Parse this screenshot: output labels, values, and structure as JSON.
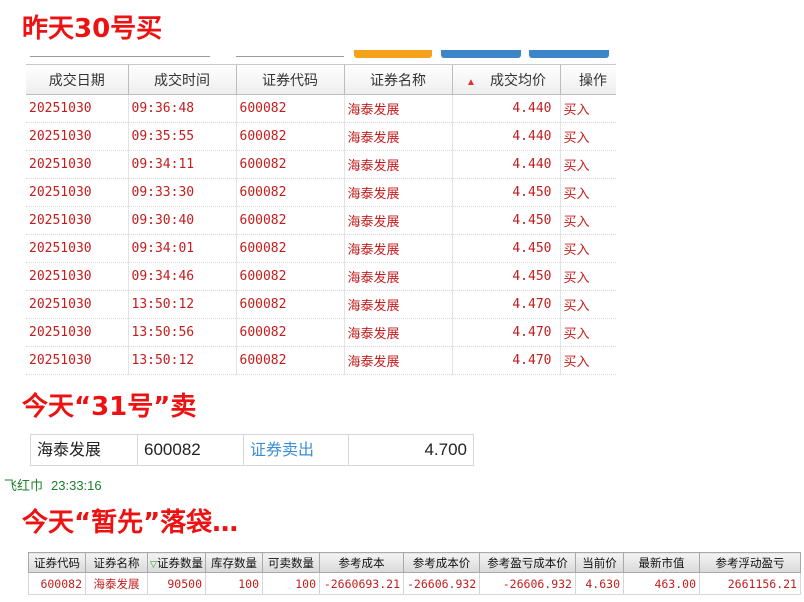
{
  "headings": {
    "bought": "昨天30号买",
    "sold": "今天“31号”卖",
    "result": "今天“暂先”落袋…"
  },
  "colors": {
    "heading": "#ee1111",
    "trade_text": "#c41c1c",
    "link": "#3d8fd6",
    "orange_button": "#f4a21a",
    "blue_button": "#3e84c8"
  },
  "trades": {
    "columns": [
      "成交日期",
      "成交时间",
      "证券代码",
      "证券名称",
      "成交均价",
      "操作"
    ],
    "sort_indicator": "▲",
    "rows": [
      [
        "20251030",
        "09:36:48",
        "600082",
        "海泰发展",
        "4.440",
        "买入"
      ],
      [
        "20251030",
        "09:35:55",
        "600082",
        "海泰发展",
        "4.440",
        "买入"
      ],
      [
        "20251030",
        "09:34:11",
        "600082",
        "海泰发展",
        "4.440",
        "买入"
      ],
      [
        "20251030",
        "09:33:30",
        "600082",
        "海泰发展",
        "4.450",
        "买入"
      ],
      [
        "20251030",
        "09:30:40",
        "600082",
        "海泰发展",
        "4.450",
        "买入"
      ],
      [
        "20251030",
        "09:34:01",
        "600082",
        "海泰发展",
        "4.450",
        "买入"
      ],
      [
        "20251030",
        "09:34:46",
        "600082",
        "海泰发展",
        "4.450",
        "买入"
      ],
      [
        "20251030",
        "13:50:12",
        "600082",
        "海泰发展",
        "4.470",
        "买入"
      ],
      [
        "20251030",
        "13:50:56",
        "600082",
        "海泰发展",
        "4.470",
        "买入"
      ],
      [
        "20251030",
        "13:50:12",
        "600082",
        "海泰发展",
        "4.470",
        "买入"
      ]
    ]
  },
  "sell": {
    "name": "海泰发展",
    "code": "600082",
    "operation": "证券卖出",
    "price": "4.700"
  },
  "notification": {
    "source": "飞红巾",
    "time": "23:33:16"
  },
  "position": {
    "columns": [
      "证券代码",
      "证券名称",
      "证券数量",
      "库存数量",
      "可卖数量",
      "参考成本",
      "参考成本价",
      "参考盈亏成本价",
      "当前价",
      "最新市值",
      "参考浮动盈亏"
    ],
    "sort_mark": "▽",
    "row": [
      "600082",
      "海泰发展",
      "90500",
      "100",
      "100",
      "-2660693.21",
      "-26606.932",
      "-26606.932",
      "4.630",
      "463.00",
      "2661156.21"
    ]
  }
}
